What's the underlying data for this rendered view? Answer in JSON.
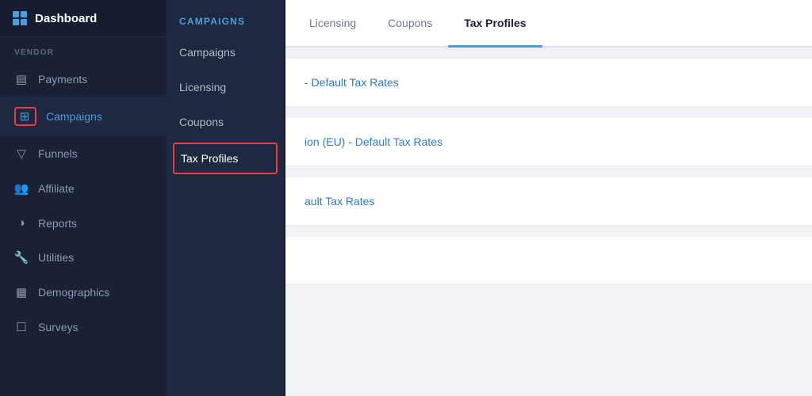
{
  "sidebar": {
    "header": {
      "label": "Dashboard"
    },
    "vendor_label": "VENDOR",
    "items": [
      {
        "id": "payments",
        "label": "Payments",
        "icon": "▤"
      },
      {
        "id": "campaigns",
        "label": "Campaigns",
        "icon": "⊞",
        "active": true
      },
      {
        "id": "funnels",
        "label": "Funnels",
        "icon": "▼"
      },
      {
        "id": "affiliate",
        "label": "Affiliate",
        "icon": "👥"
      },
      {
        "id": "reports",
        "label": "Reports",
        "icon": "◑"
      },
      {
        "id": "utilities",
        "label": "Utilities",
        "icon": "🔧"
      },
      {
        "id": "demographics",
        "label": "Demographics",
        "icon": "▦"
      },
      {
        "id": "surveys",
        "label": "Surveys",
        "icon": "☐"
      }
    ]
  },
  "submenu": {
    "header": "CAMPAIGNS",
    "items": [
      {
        "id": "campaigns",
        "label": "Campaigns",
        "active": false
      },
      {
        "id": "licensing",
        "label": "Licensing",
        "active": false
      },
      {
        "id": "coupons",
        "label": "Coupons",
        "active": false
      },
      {
        "id": "tax-profiles",
        "label": "Tax Profiles",
        "active": true
      }
    ]
  },
  "tabs": [
    {
      "id": "licensing",
      "label": "Licensing",
      "active": false
    },
    {
      "id": "coupons",
      "label": "Coupons",
      "active": false
    },
    {
      "id": "tax-profiles",
      "label": "Tax Profiles",
      "active": true
    }
  ],
  "tax_rows": [
    {
      "id": 1,
      "label": "- Default Tax Rates"
    },
    {
      "id": 2,
      "label": "ion (EU) - Default Tax Rates"
    },
    {
      "id": 3,
      "label": "ault Tax Rates"
    }
  ]
}
